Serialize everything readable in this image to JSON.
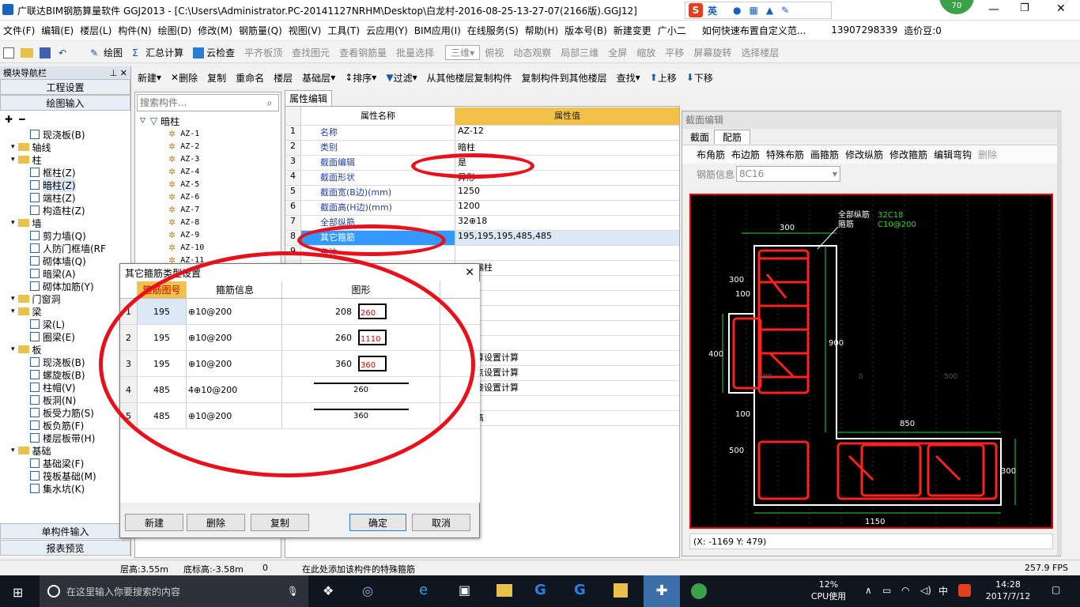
{
  "window": {
    "title": "广联达BIM钢筋算量软件 GGJ2013 - [C:\\Users\\Administrator.PC-20141127NRHM\\Desktop\\白龙村-2016-08-25-13-27-07(2166版).GGJ12]",
    "score": "70",
    "ime": "英"
  },
  "menu": [
    "文件(F)",
    "编辑(E)",
    "楼层(L)",
    "构件(N)",
    "绘图(D)",
    "修改(M)",
    "钢筋量(Q)",
    "视图(V)",
    "工具(T)",
    "云应用(Y)",
    "BIM应用(I)",
    "在线服务(S)",
    "帮助(H)",
    "版本号(B)",
    "新建变更",
    "广小二",
    "如何快速布置自定义范...",
    "13907298339",
    "造价豆:0"
  ],
  "toolbar1": [
    "绘图",
    "汇总计算",
    "云检查",
    "平齐板顶",
    "查找图元",
    "查看钢筋量",
    "批量选择",
    "三维",
    "俯视",
    "动态观察",
    "局部三维",
    "全屏",
    "缩放",
    "平移",
    "屏幕旋转",
    "选择楼层"
  ],
  "toolbar2": [
    "新建",
    "删除",
    "复制",
    "重命名",
    "楼层",
    "基础层",
    "排序",
    "过滤",
    "从其他楼层复制构件",
    "复制构件到其他楼层",
    "查找",
    "上移",
    "下移"
  ],
  "nav": {
    "title": "模块导航栏",
    "tabs": [
      "工程设置",
      "绘图输入"
    ],
    "bottom": [
      "单构件输入",
      "报表预览"
    ],
    "tree": [
      [
        "1",
        "现浇板(B)"
      ],
      [
        "0",
        "轴线"
      ],
      [
        "0",
        "柱"
      ],
      [
        "1",
        "框柱(Z)"
      ],
      [
        "1",
        "暗柱(Z)"
      ],
      [
        "1",
        "端柱(Z)"
      ],
      [
        "1",
        "构造柱(Z)"
      ],
      [
        "0",
        "墙"
      ],
      [
        "1",
        "剪力墙(Q)"
      ],
      [
        "1",
        "人防门框墙(RF"
      ],
      [
        "1",
        "砌体墙(Q)"
      ],
      [
        "1",
        "暗梁(A)"
      ],
      [
        "1",
        "砌体加筋(Y)"
      ],
      [
        "0",
        "门窗洞"
      ],
      [
        "0",
        "梁"
      ],
      [
        "1",
        "梁(L)"
      ],
      [
        "1",
        "圈梁(E)"
      ],
      [
        "0",
        "板"
      ],
      [
        "1",
        "现浇板(B)"
      ],
      [
        "1",
        "螺旋板(B)"
      ],
      [
        "1",
        "柱帽(V)"
      ],
      [
        "1",
        "板洞(N)"
      ],
      [
        "1",
        "板受力筋(S)"
      ],
      [
        "1",
        "板负筋(F)"
      ],
      [
        "1",
        "楼层板带(H)"
      ],
      [
        "0",
        "基础"
      ],
      [
        "1",
        "基础梁(F)"
      ],
      [
        "1",
        "筏板基础(M)"
      ],
      [
        "1",
        "集水坑(K)"
      ]
    ]
  },
  "clist": {
    "search_placeholder": "搜索构件...",
    "root": "暗柱",
    "items": [
      "AZ-1",
      "AZ-2",
      "AZ-3",
      "AZ-4",
      "AZ-5",
      "AZ-6",
      "AZ-7",
      "AZ-8",
      "AZ-9",
      "AZ-10",
      "AZ-11"
    ]
  },
  "props": {
    "tab": "属性编辑",
    "h_name": "属性名称",
    "h_val": "属性值",
    "rows": [
      [
        "1",
        "名称",
        "AZ-12"
      ],
      [
        "2",
        "类别",
        "暗柱"
      ],
      [
        "3",
        "截面编辑",
        "是"
      ],
      [
        "4",
        "截面形状",
        "异形"
      ],
      [
        "5",
        "截面宽(B边)(mm)",
        "1250"
      ],
      [
        "6",
        "截面高(H边)(mm)",
        "1200"
      ],
      [
        "7",
        "全部纵筋",
        "32⊕18"
      ],
      [
        "8",
        "其它箍筋",
        "195,195,195,485,485"
      ],
      [
        "9",
        "备注",
        ""
      ]
    ],
    "extra": [
      "同墙端柱",
      "",
      "",
      "",
      "箍筋",
      "",
      "从计算设置计算",
      "从节点设置计算",
      "从搭接设置计算",
      "标高",
      "底标高"
    ]
  },
  "section": {
    "title": "截面编辑",
    "tabs": [
      "截面",
      "配筋"
    ],
    "tools": [
      "布角筋",
      "布边筋",
      "特殊布筋",
      "画箍筋",
      "修改纵筋",
      "修改箍筋",
      "编辑弯钩",
      "删除"
    ],
    "rebar_label": "钢筋信息",
    "rebar_value": "8C16",
    "legend": [
      "全部纵筋",
      "箍筋"
    ],
    "legend_vals": [
      "32C18",
      "C10@200"
    ],
    "coords": "(X: -1169 Y: 479)",
    "dims": [
      "300",
      "300",
      "100",
      "400",
      "900",
      "100",
      "850",
      "500",
      "300",
      "1150"
    ],
    "axis": [
      "-500",
      "0",
      "500"
    ]
  },
  "dialog": {
    "title": "其它箍筋类型设置",
    "h": [
      "箍筋图号",
      "箍筋信息",
      "图形"
    ],
    "rows": [
      [
        "1",
        "195",
        "⊕10@200",
        "208",
        "260"
      ],
      [
        "2",
        "195",
        "⊕10@200",
        "260",
        "1110"
      ],
      [
        "3",
        "195",
        "⊕10@200",
        "360",
        "360"
      ],
      [
        "4",
        "485",
        "4⊕10@200",
        "",
        "260"
      ],
      [
        "5",
        "485",
        "⊕10@200",
        "",
        "360"
      ]
    ],
    "buttons": [
      "新建",
      "删除",
      "复制",
      "确定",
      "取消"
    ]
  },
  "status": {
    "floor_h": "层高:3.55m",
    "bottom_h": "底标高:-3.58m",
    "zero": "0",
    "hint": "在此处添加该构件的特殊箍筋",
    "fps": "257.9 FPS"
  },
  "taskbar": {
    "search": "在这里输入你要搜索的内容",
    "cpu": "12%",
    "cpu_label": "CPU使用",
    "lang": "中",
    "time": "14:28",
    "date": "2017/7/12"
  },
  "colors": {
    "selection": "#3399ff",
    "annot": "#e8101a",
    "canvas": "#000000",
    "rebar": "#ff2020"
  }
}
